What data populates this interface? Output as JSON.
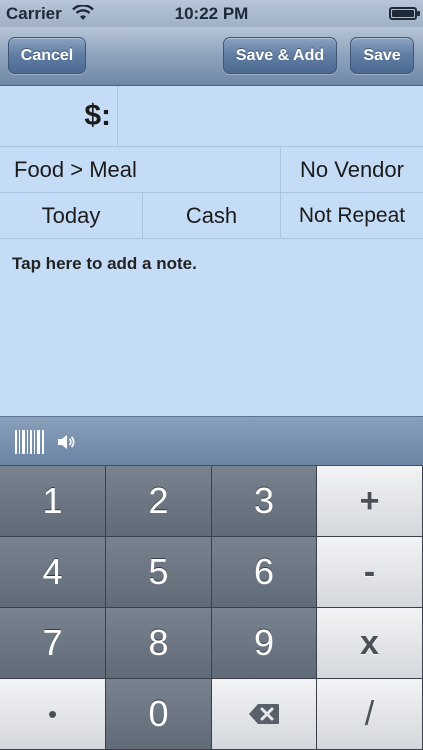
{
  "status_bar": {
    "carrier": "Carrier",
    "time": "10:22 PM",
    "wifi_icon": "wifi-icon",
    "battery_icon": "battery-icon"
  },
  "navbar": {
    "cancel_label": "Cancel",
    "save_add_label": "Save & Add",
    "save_label": "Save"
  },
  "form": {
    "currency_label": "$:",
    "amount_value": "",
    "category": "Food > Meal",
    "vendor": "No Vendor",
    "date": "Today",
    "payment": "Cash",
    "repeat": "Not Repeat",
    "note_placeholder": "Tap here to add a note."
  },
  "accessory_bar": {
    "icons": [
      "barcode-icon",
      "speaker-icon"
    ]
  },
  "keypad": {
    "keys": [
      [
        "1",
        "2",
        "3",
        "+"
      ],
      [
        "4",
        "5",
        "6",
        "-"
      ],
      [
        "7",
        "8",
        "9",
        "x"
      ],
      [
        "•",
        "0",
        "⌫",
        "/"
      ]
    ]
  },
  "colors": {
    "navbar": "#7d94b2",
    "form_background": "#c5dcf6",
    "dark_key": "#6b7581",
    "light_key": "#e6e8ec"
  }
}
